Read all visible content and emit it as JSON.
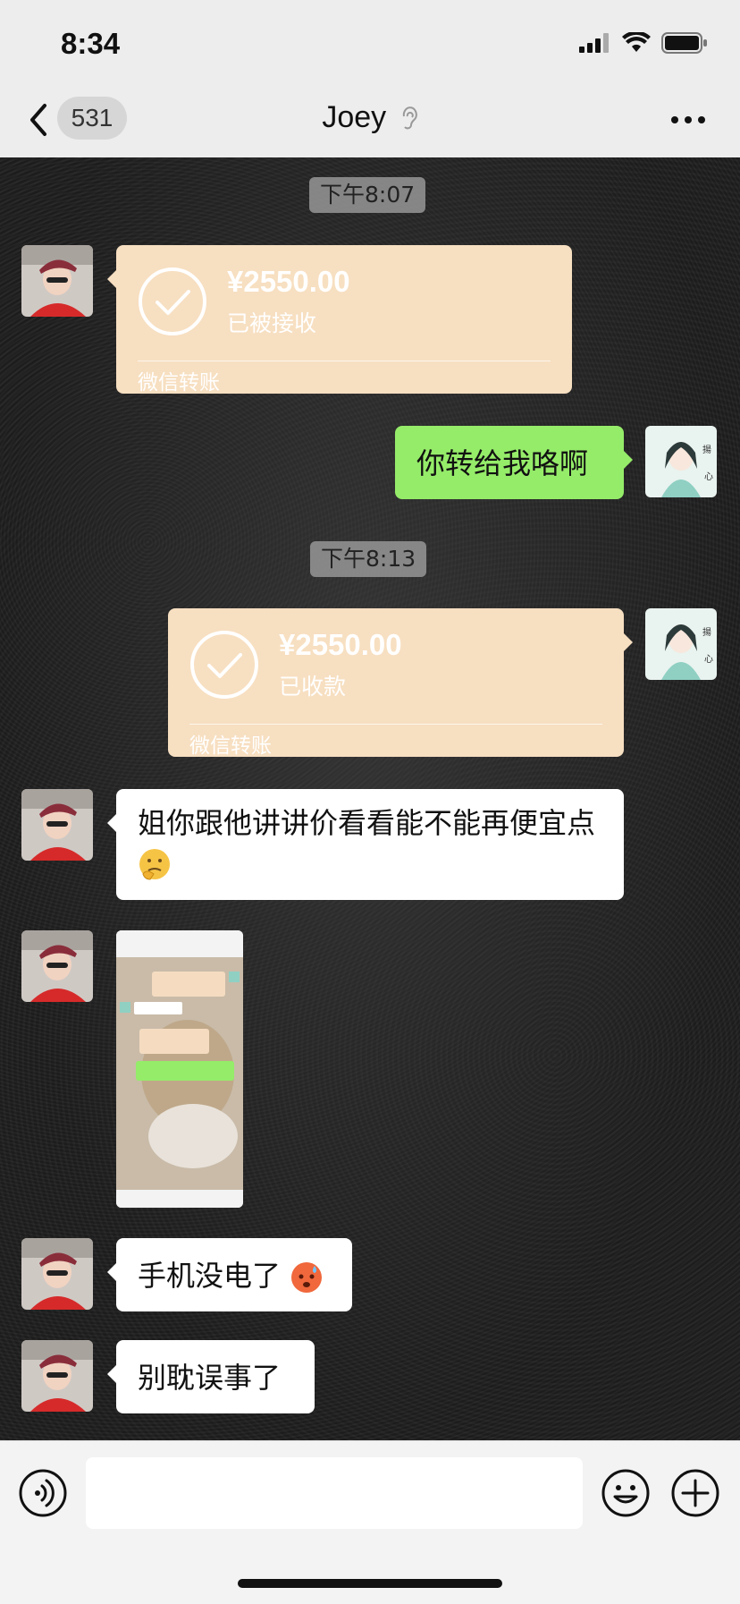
{
  "status_bar": {
    "time": "8:34",
    "icons": [
      "signal-icon",
      "wifi-icon",
      "battery-icon"
    ]
  },
  "nav": {
    "back_icon": "chevron-left-icon",
    "unread_count": "531",
    "title": "Joey",
    "title_icon": "ear-icon",
    "more_icon": "ellipsis-icon"
  },
  "messages": [
    {
      "type": "time",
      "text": "下午8:07"
    },
    {
      "type": "transfer",
      "side": "left",
      "amount": "¥2550.00",
      "status": "已被接收",
      "label": "微信转账"
    },
    {
      "type": "text",
      "side": "right",
      "text": "你转给我咯啊"
    },
    {
      "type": "time",
      "text": "下午8:13"
    },
    {
      "type": "transfer",
      "side": "right",
      "amount": "¥2550.00",
      "status": "已收款",
      "label": "微信转账"
    },
    {
      "type": "text",
      "side": "left",
      "text": "姐你跟他讲讲价看看能不能再便宜点",
      "emoji": "thinking-face-icon"
    },
    {
      "type": "image",
      "side": "left",
      "description_icon": "screenshot-thumbnail"
    },
    {
      "type": "text",
      "side": "left",
      "text": "手机没电了",
      "emoji": "worried-face-icon"
    },
    {
      "type": "text",
      "side": "left",
      "text": "别耽误事了"
    }
  ],
  "input_bar": {
    "placeholder": "",
    "icons": [
      "voice-icon",
      "emoji-icon",
      "plus-icon"
    ]
  },
  "colors": {
    "outgoing_bubble": "#95ec69",
    "incoming_bubble": "#ffffff",
    "transfer_card": "#f7dfc1"
  }
}
